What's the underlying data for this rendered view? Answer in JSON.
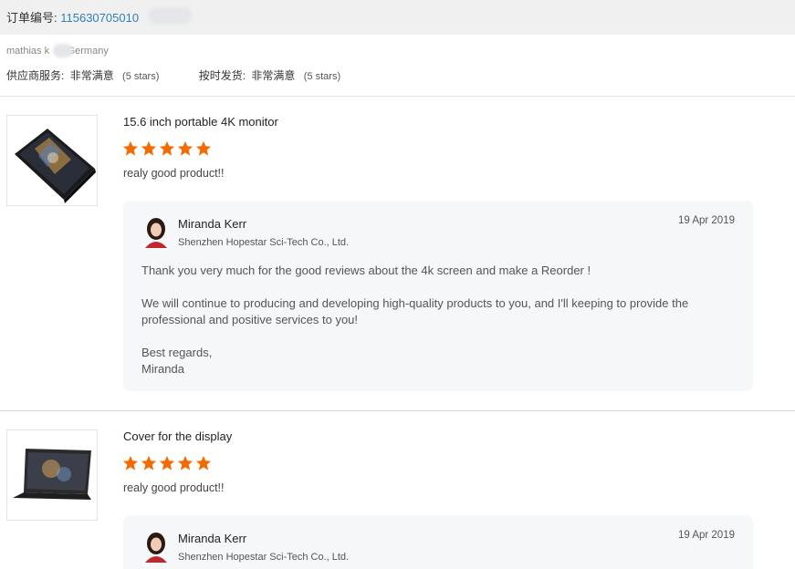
{
  "order": {
    "label": "订单编号:",
    "number": "115630705010"
  },
  "buyer": {
    "name": "mathias k",
    "country": "l,Germany"
  },
  "ratings": [
    {
      "label": "供应商服务:",
      "value": "非常满意",
      "stars": "(5 stars)"
    },
    {
      "label": "按时发货:",
      "value": "非常满意",
      "stars": "(5 stars)"
    }
  ],
  "accent_colors": {
    "star": "#f56a00",
    "link": "#2f7fb9",
    "reply_bg": "#f6f7f9"
  },
  "items": [
    {
      "title": "15.6 inch portable 4K monitor",
      "rating": 5,
      "review": "realy good product!!",
      "reply": {
        "name": "Miranda Kerr",
        "company": "Shenzhen Hopestar Sci-Tech Co., Ltd.",
        "date": "19 Apr 2019",
        "p1": "Thank you very much for the good reviews about the 4k screen and make a Reorder !",
        "p2a": "We will continue to producing and developing high-quality products to you, and I'll keeping to provide the",
        "p2b": "professional and positive services to you!",
        "p3a": "Best regards,",
        "p3b": "Miranda"
      }
    },
    {
      "title": "Cover for the display",
      "rating": 5,
      "review": "realy good product!!",
      "reply": {
        "name": "Miranda Kerr",
        "company": "Shenzhen Hopestar Sci-Tech Co., Ltd.",
        "date": "19 Apr 2019"
      }
    }
  ]
}
